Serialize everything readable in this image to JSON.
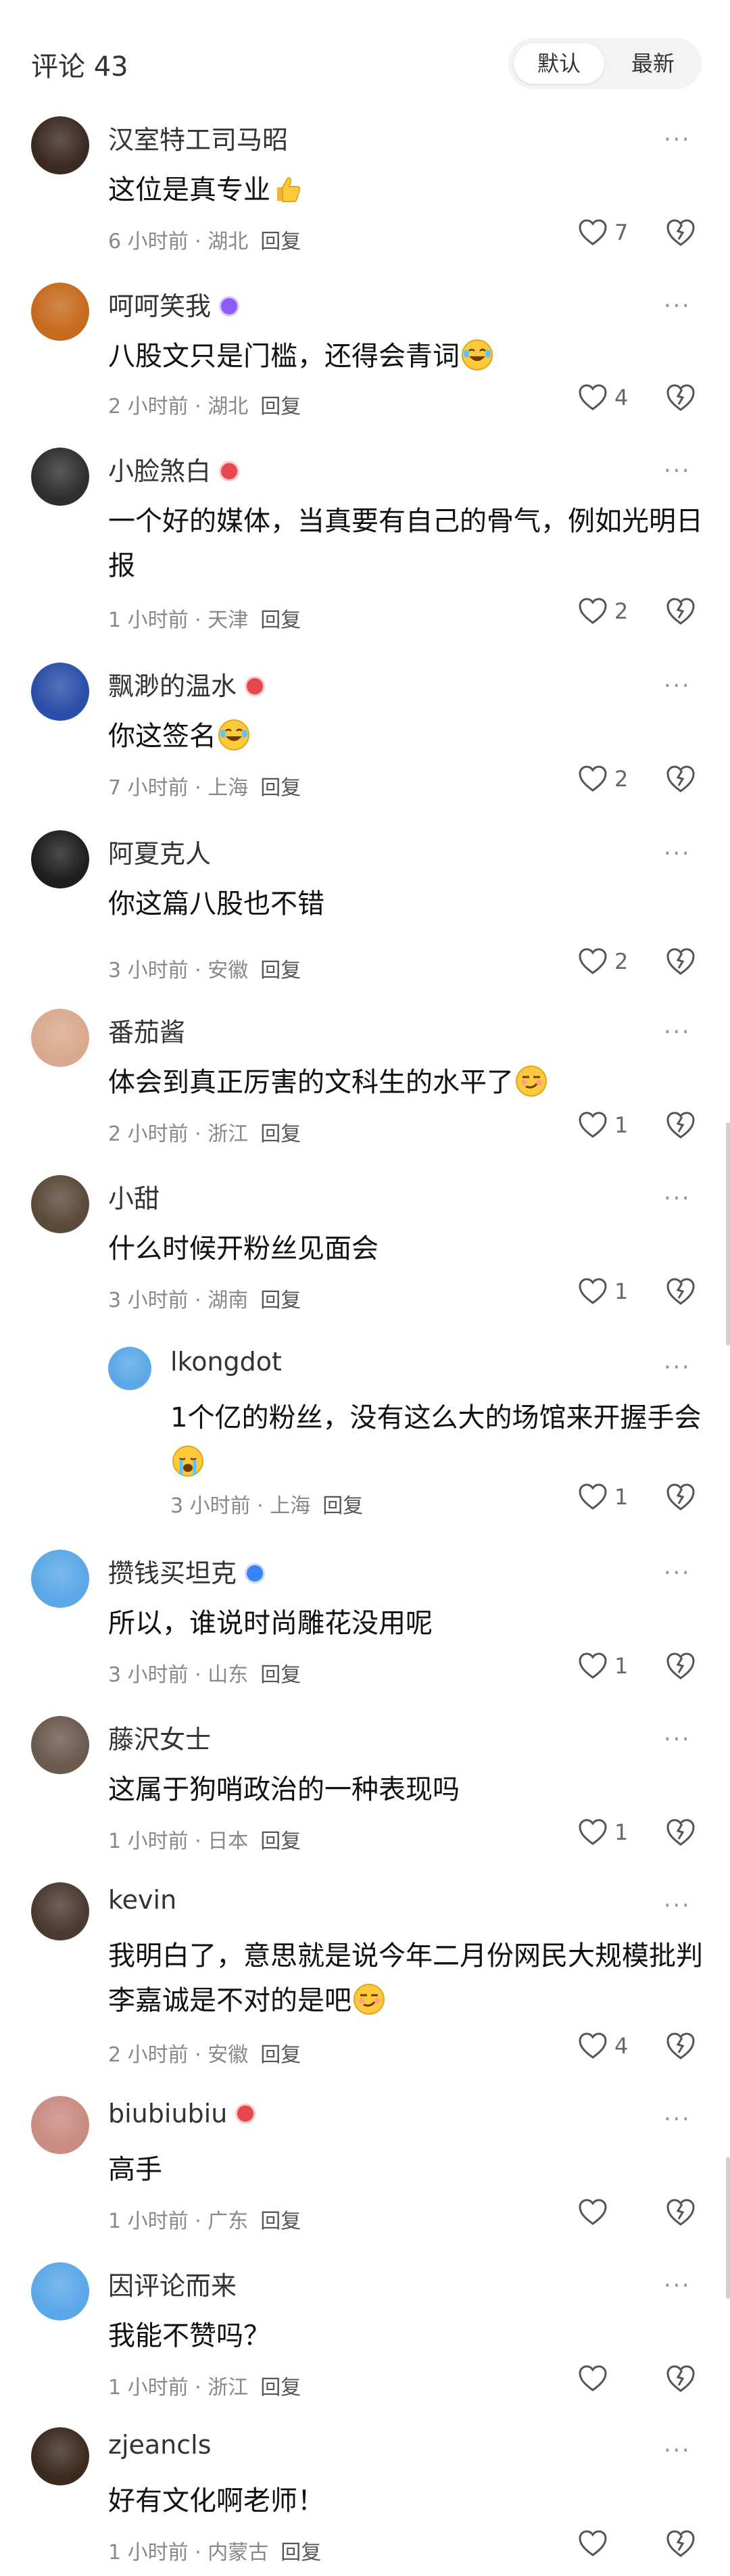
{
  "header": {
    "title": "评论 43",
    "sort_default": "默认",
    "sort_latest": "最新"
  },
  "more_icon": "···",
  "reply_label": "回复",
  "comments": [
    {
      "name": "汉室特工司马昭",
      "text": "这位是真专业",
      "time": "6 小时前",
      "location": "湖北",
      "likes": "7",
      "avatar_color": "#3a2a22"
    },
    {
      "name": "呵呵笑我",
      "text": "八股文只是门槛，还得会青词",
      "time": "2 小时前",
      "location": "湖北",
      "likes": "4",
      "avatar_color": "#c66a1e"
    },
    {
      "name": "小脸煞白",
      "text": "一个好的媒体，当真要有自己的骨气，例如光明日报",
      "time": "1 小时前",
      "location": "天津",
      "likes": "2",
      "avatar_color": "#2f2f2f"
    },
    {
      "name": "飘渺的温水",
      "text": "你这签名",
      "time": "7 小时前",
      "location": "上海",
      "likes": "2",
      "avatar_color": "#2a4fa8"
    },
    {
      "name": "阿夏克人",
      "text": "你这篇八股也不错",
      "time": "3 小时前",
      "location": "安徽",
      "likes": "2",
      "avatar_color": "#1e1e1e"
    },
    {
      "name": "番茄酱",
      "text": "体会到真正厉害的文科生的水平了",
      "time": "2 小时前",
      "location": "浙江",
      "likes": "1",
      "avatar_color": "#d9a98d"
    },
    {
      "name": "小甜",
      "text": "什么时候开粉丝见面会",
      "time": "3 小时前",
      "location": "湖南",
      "likes": "1",
      "avatar_color": "#5a4a3a"
    },
    {
      "name": "lkongdot",
      "text": "1个亿的粉丝，没有这么大的场馆来开握手会",
      "time": "3 小时前",
      "location": "上海",
      "likes": "1",
      "avatar_color": "#5aa8e8"
    },
    {
      "name": "攒钱买坦克",
      "text": "所以，谁说时尚雕花没用呢",
      "time": "3 小时前",
      "location": "山东",
      "likes": "1",
      "avatar_color": "#5aa8e8"
    },
    {
      "name": "藤沢女士",
      "text": "这属于狗哨政治的一种表现吗",
      "time": "1 小时前",
      "location": "日本",
      "likes": "1",
      "avatar_color": "#6b5a4e"
    },
    {
      "name": "kevin",
      "text": "我明白了，意思就是说今年二月份网民大规模批判李嘉诚是不对的是吧",
      "time": "2 小时前",
      "location": "安徽",
      "likes": "4",
      "avatar_color": "#4a3a30"
    },
    {
      "name": "biubiubiu",
      "text": "高手",
      "time": "1 小时前",
      "location": "广东",
      "likes": "",
      "avatar_color": "#c98b82"
    },
    {
      "name": "因评论而来",
      "text": "我能不赞吗？",
      "time": "1 小时前",
      "location": "浙江",
      "likes": "",
      "avatar_color": "#5aa8e8"
    },
    {
      "name": "zjeancls",
      "text": "好有文化啊老师！",
      "time": "1 小时前",
      "location": "内蒙古",
      "likes": "",
      "avatar_color": "#3b2b1e"
    }
  ]
}
